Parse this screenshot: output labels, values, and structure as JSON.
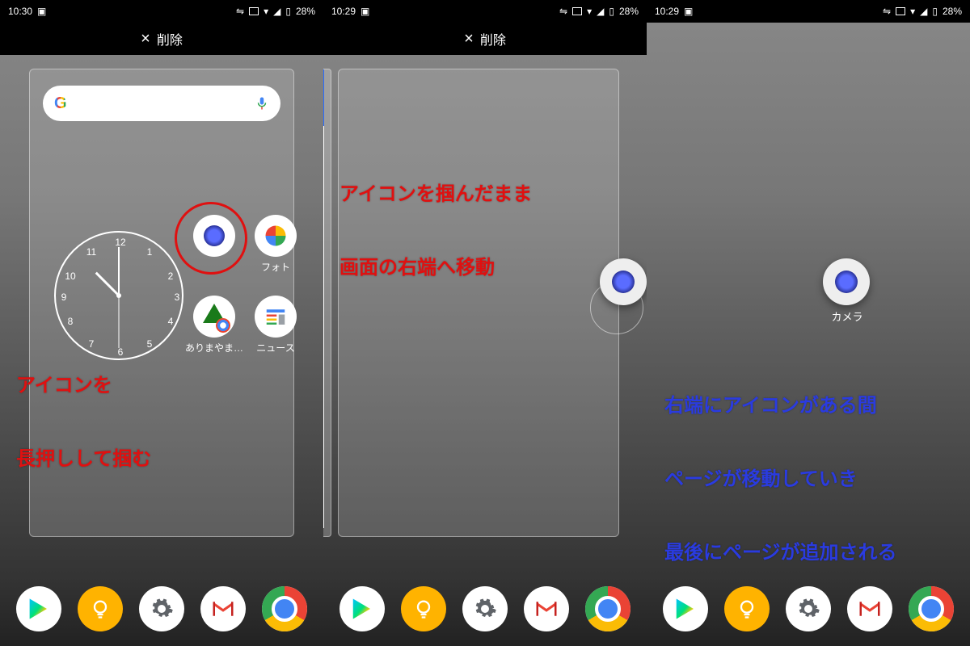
{
  "panels": [
    {
      "status_time": "10:30",
      "battery": "28%",
      "delete_label": "削除",
      "apps": {
        "camera": "カメラ",
        "photo": "フォト",
        "arima": "ありまやま…",
        "news": "ニュース"
      },
      "annotation_main": "アイコンを\n\n長押しして掴む"
    },
    {
      "status_time": "10:29",
      "battery": "28%",
      "delete_label": "削除",
      "annotation_top": "アイコンを掴んだまま\n\n画面の右端へ移動"
    },
    {
      "status_time": "10:29",
      "battery": "28%",
      "camera_label": "カメラ",
      "annotation_blue": "右端にアイコンがある間\n\nページが移動していき\n\n最後にページが追加される"
    }
  ],
  "clock_numbers": [
    "12",
    "1",
    "2",
    "3",
    "4",
    "5",
    "6",
    "7",
    "8",
    "9",
    "10",
    "11"
  ],
  "dock": [
    "play",
    "bulb",
    "gear",
    "gmail",
    "chrome"
  ]
}
